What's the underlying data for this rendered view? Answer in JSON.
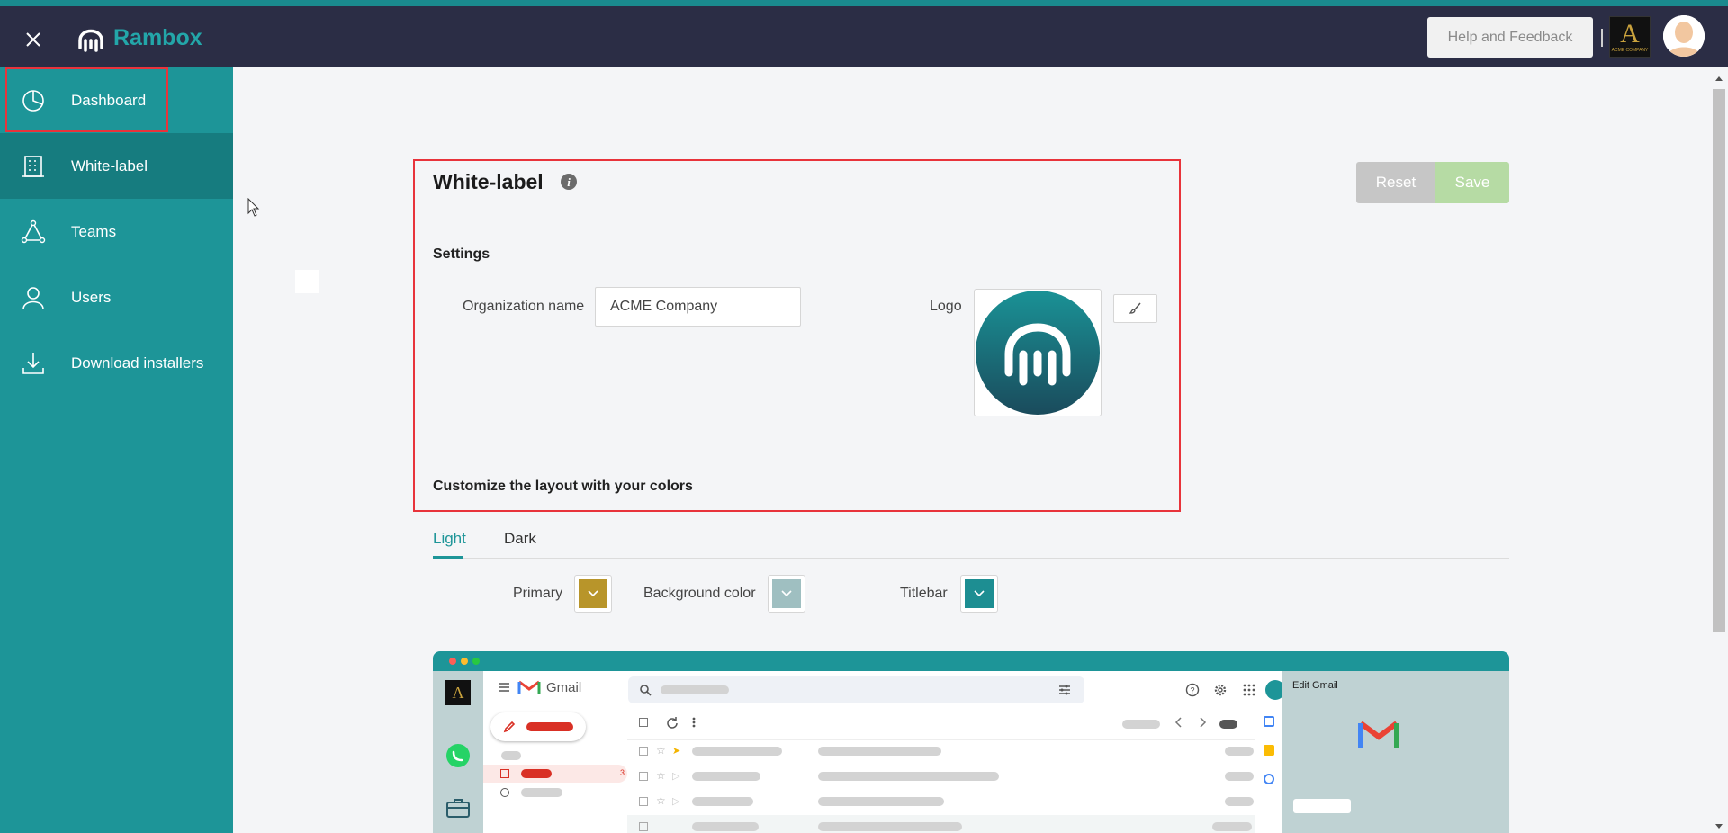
{
  "topbar": {
    "brand_name": "Rambox",
    "help_label": "Help and Feedback",
    "org_logo_letter": "A",
    "org_logo_text": "ACME COMPANY"
  },
  "sidebar": {
    "items": [
      {
        "label": "Dashboard",
        "icon": "pie-chart-icon"
      },
      {
        "label": "White-label",
        "icon": "building-icon",
        "active": true
      },
      {
        "label": "Teams",
        "icon": "team-icon"
      },
      {
        "label": "Users",
        "icon": "user-icon"
      },
      {
        "label": "Download installers",
        "icon": "download-icon"
      }
    ]
  },
  "main": {
    "title": "White-label",
    "reset_label": "Reset",
    "save_label": "Save",
    "settings_heading": "Settings",
    "org_name_label": "Organization name",
    "org_name_value": "ACME Company",
    "logo_label": "Logo",
    "customize_heading": "Customize the layout with your colors",
    "tabs": [
      {
        "label": "Light",
        "active": true
      },
      {
        "label": "Dark",
        "active": false
      }
    ],
    "colors": [
      {
        "label": "Primary",
        "value": "#b8952a"
      },
      {
        "label": "Background color",
        "value": "#9fbfc1"
      },
      {
        "label": "Titlebar",
        "value": "#1d8e92"
      }
    ]
  },
  "preview": {
    "gmail_label": "Gmail",
    "edit_title": "Edit Gmail",
    "rail_logo_letter": "A",
    "badge_count": "3"
  },
  "colors": {
    "topbar": "#2b2d45",
    "sidebar": "#1d9598",
    "accent": "#23a6a9",
    "highlight": "#e8333b"
  }
}
